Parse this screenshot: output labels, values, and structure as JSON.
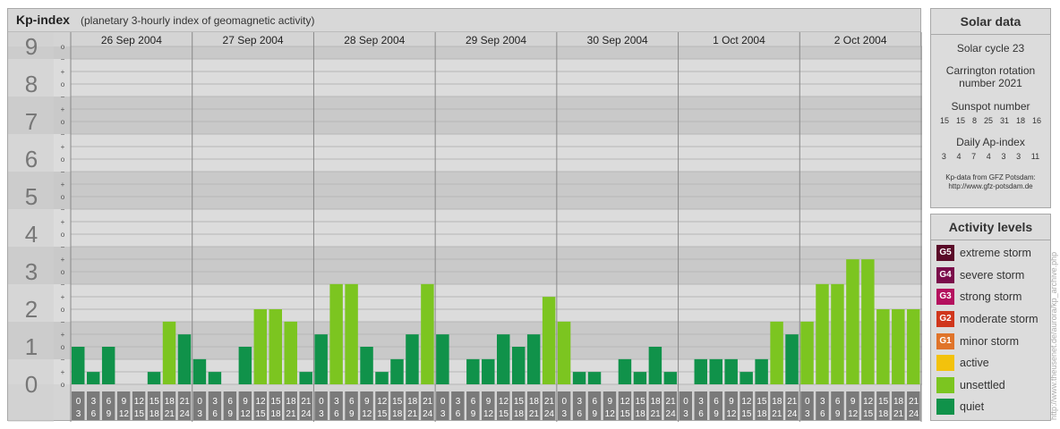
{
  "header": {
    "title": "Kp-index",
    "subtitle": "(planetary 3-hourly index of geomagnetic activity)"
  },
  "chart_data": {
    "type": "bar",
    "y_axis_labels": [
      "0",
      "1",
      "2",
      "3",
      "4",
      "5",
      "6",
      "7",
      "8",
      "9"
    ],
    "minor_marks": [
      "o",
      "+",
      "−"
    ],
    "ylim": [
      0,
      9.33
    ],
    "days": [
      "26 Sep 2004",
      "27 Sep 2004",
      "28 Sep 2004",
      "29 Sep 2004",
      "30 Sep 2004",
      "1 Oct 2004",
      "2 Oct 2004"
    ],
    "hour_start_labels": [
      "0",
      "3",
      "6",
      "9",
      "12",
      "15",
      "18",
      "21"
    ],
    "hour_end_labels": [
      "3",
      "6",
      "9",
      "12",
      "15",
      "18",
      "21",
      "24"
    ],
    "values": [
      [
        1.0,
        0.33,
        1.0,
        0.0,
        0.0,
        0.33,
        1.67,
        1.33
      ],
      [
        0.67,
        0.33,
        0.0,
        1.0,
        2.0,
        2.0,
        1.67,
        0.33
      ],
      [
        1.33,
        2.67,
        2.67,
        1.0,
        0.33,
        0.67,
        1.33,
        2.67
      ],
      [
        1.33,
        0.0,
        0.67,
        0.67,
        1.33,
        1.0,
        1.33,
        2.33
      ],
      [
        1.67,
        0.33,
        0.33,
        0.0,
        0.67,
        0.33,
        1.0,
        0.33
      ],
      [
        0.0,
        0.67,
        0.67,
        0.67,
        0.33,
        0.67,
        1.67,
        1.33
      ],
      [
        1.67,
        2.67,
        2.67,
        3.33,
        3.33,
        2.0,
        2.0,
        2.0
      ]
    ],
    "colors": {
      "quiet": "#10924a",
      "unsettled": "#7cc520"
    },
    "grid": true
  },
  "solar": {
    "title": "Solar data",
    "cycle": "Solar cycle 23",
    "rotation_line1": "Carrington rotation",
    "rotation_line2": "number 2021",
    "sunspot_label": "Sunspot number",
    "sunspot_values": [
      "15",
      "15",
      "8",
      "25",
      "31",
      "18",
      "16"
    ],
    "ap_label": "Daily Ap-index",
    "ap_values": [
      "3",
      "4",
      "7",
      "4",
      "3",
      "3",
      "11"
    ],
    "source_line1": "Kp-data from GFZ Potsdam:",
    "source_line2": "http://www.gfz-potsdam.de"
  },
  "activity": {
    "title": "Activity levels",
    "levels": [
      {
        "badge": "G5",
        "label": "extreme storm",
        "color": "#5a0a28"
      },
      {
        "badge": "G4",
        "label": "severe storm",
        "color": "#7a0c4a"
      },
      {
        "badge": "G3",
        "label": "strong storm",
        "color": "#b4105e"
      },
      {
        "badge": "G2",
        "label": "moderate storm",
        "color": "#d0361c"
      },
      {
        "badge": "G1",
        "label": "minor storm",
        "color": "#e0742a"
      },
      {
        "badge": "",
        "label": "active",
        "color": "#f3c20c"
      },
      {
        "badge": "",
        "label": "unsettled",
        "color": "#7cc520"
      },
      {
        "badge": "",
        "label": "quiet",
        "color": "#10924a"
      }
    ]
  },
  "credit": "http://www.theusenet.de/aurora/kp_archive.php"
}
